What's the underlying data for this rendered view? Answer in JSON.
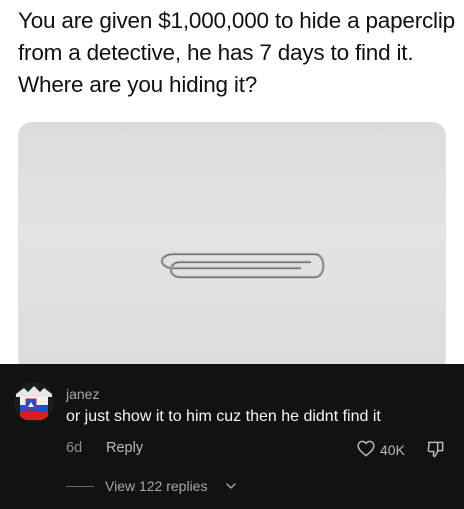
{
  "post": {
    "text": "You are given $1,000,000 to hide a paperclip from a detective, he has 7 days to find it. Where are you hiding it?"
  },
  "comment": {
    "username": "janez",
    "text": "or just show it to him cuz then he didnt find it",
    "age": "6d",
    "reply_label": "Reply",
    "like_count": "40K",
    "view_replies": "View 122 replies"
  },
  "icons": {
    "like": "heart-icon",
    "dislike": "dislike-icon",
    "expand": "chevron-down-icon",
    "avatar_flag": "slovenia-flag-icon"
  },
  "colors": {
    "panel_bg": "#121212",
    "muted_text": "#a8a8a8",
    "comment_text": "#f5f5f5"
  }
}
